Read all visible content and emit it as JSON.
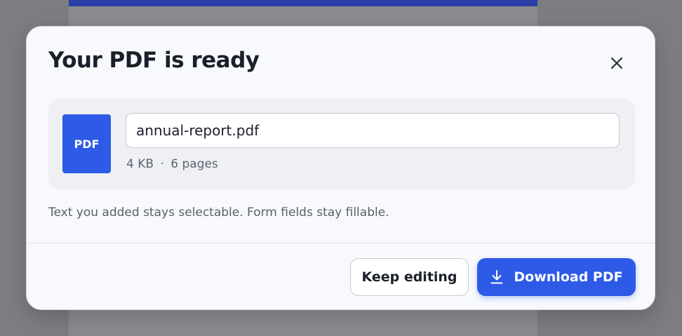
{
  "dialog": {
    "title": "Your PDF is ready",
    "close_icon": "close-icon"
  },
  "file": {
    "thumb_label": "PDF",
    "filename": "annual-report.pdf",
    "size": "4  KB",
    "separator": "·",
    "pages": "6 pages"
  },
  "hint": "Text you added stays selectable. Form fields stay fillable.",
  "actions": {
    "keep_editing_label": "Keep editing",
    "download_label": "Download PDF",
    "download_icon": "download-icon"
  },
  "colors": {
    "accent": "#2d5ae6",
    "backdrop": "#7c7d80",
    "modal_bg": "#f7f9fc",
    "card_bg": "#eef0f4"
  }
}
